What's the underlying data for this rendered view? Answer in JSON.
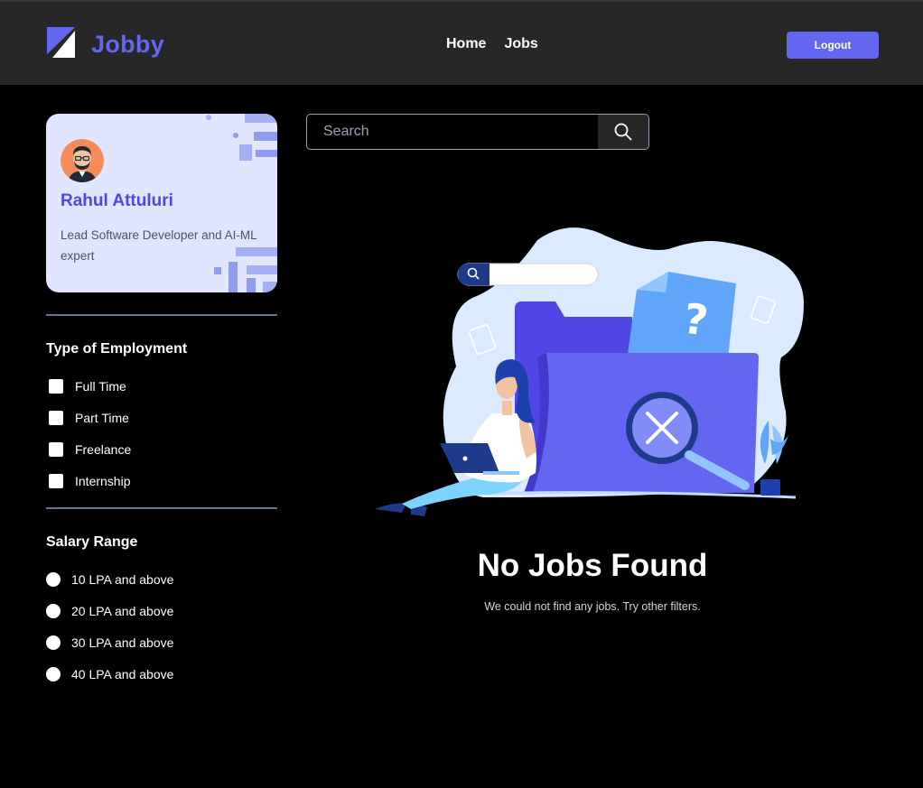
{
  "header": {
    "brand": "Jobby",
    "nav": [
      {
        "label": "Home"
      },
      {
        "label": "Jobs"
      }
    ],
    "logout_label": "Logout"
  },
  "profile": {
    "name": "Rahul Attuluri",
    "bio": "Lead Software Developer and AI-ML expert"
  },
  "employment": {
    "title": "Type of Employment",
    "options": [
      {
        "label": "Full Time",
        "checked": false
      },
      {
        "label": "Part Time",
        "checked": false
      },
      {
        "label": "Freelance",
        "checked": false
      },
      {
        "label": "Internship",
        "checked": false
      }
    ]
  },
  "salary": {
    "title": "Salary Range",
    "options": [
      {
        "label": "10 LPA and above",
        "selected": false
      },
      {
        "label": "20 LPA and above",
        "selected": false
      },
      {
        "label": "30 LPA and above",
        "selected": false
      },
      {
        "label": "40 LPA and above",
        "selected": false
      }
    ]
  },
  "search": {
    "placeholder": "Search",
    "value": ""
  },
  "empty": {
    "title": "No Jobs Found",
    "description": "We could not find any jobs. Try other filters."
  },
  "colors": {
    "accent": "#6366f1",
    "header_bg": "#272727",
    "card_bg": "#e2e5ff"
  }
}
